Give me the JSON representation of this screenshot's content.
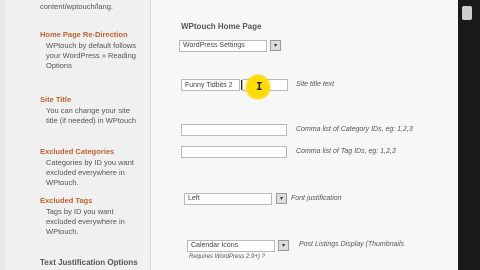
{
  "left": {
    "top_path": "content/wptouch/lang.",
    "home_redirect": {
      "title": "Home Page Re-Direction",
      "desc": [
        "WPtouch by default follows",
        "your WordPress » Reading",
        "Options"
      ]
    },
    "site_title": {
      "title": "Site Title",
      "desc": [
        "You can change your site",
        "title (if needed) in WPtouch"
      ]
    },
    "excluded_categories": {
      "title": "Excluded Categories",
      "desc": [
        "Categories by ID you want",
        "excluded everywhere in",
        "WPtouch."
      ]
    },
    "excluded_tags": {
      "title": "Excluded Tags",
      "desc": [
        "Tags by ID you want",
        "excluded everywhere in",
        "WPtouch."
      ]
    },
    "text_justification": {
      "title": "Text Justification Options"
    }
  },
  "right": {
    "home_page": {
      "label": "WPtouch Home Page",
      "select_value": "WordPress Settings"
    },
    "site_title": {
      "value": "Funny Tidbits 2",
      "hint": "Site title text"
    },
    "categories": {
      "value": "",
      "hint": "Comma list of Category IDs, eg: 1,2,3"
    },
    "tags": {
      "value": "",
      "hint": "Comma list of Tag IDs, eg: 1,2,3"
    },
    "justification": {
      "select_value": "Left",
      "hint": "Font justification"
    },
    "post_listings": {
      "select_value": "Calendar Icons",
      "hint": "Post Listings Display (Thumbnails",
      "sub_hint": "Requires WordPress 2.9+) ?"
    }
  },
  "icons": {
    "select_arrow": "dropdown-arrow-icon",
    "text_cursor": "ibeam-cursor-icon"
  }
}
